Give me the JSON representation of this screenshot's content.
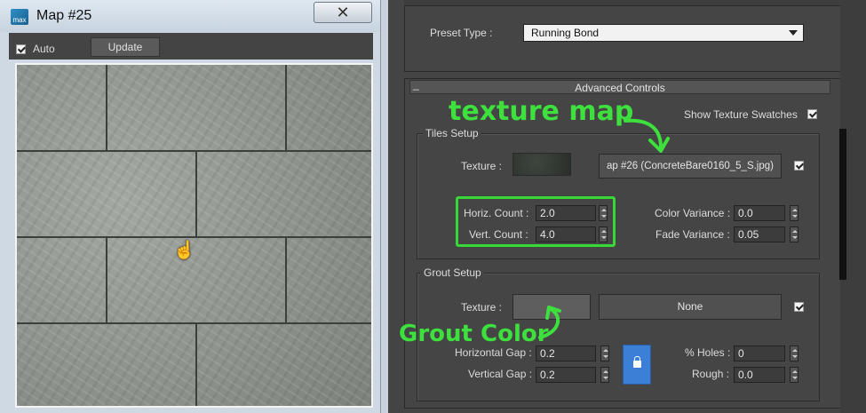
{
  "map_window": {
    "title": "Map #25",
    "close_glyph": "✕",
    "auto_label": "Auto",
    "auto_checked": true,
    "update_label": "Update"
  },
  "panel": {
    "preset_type_label": "Preset Type :",
    "preset_type_value": "Running Bond",
    "advanced_controls_title": "Advanced Controls",
    "show_texture_swatches_label": "Show Texture Swatches",
    "tiles_setup": {
      "group_label": "Tiles Setup",
      "texture_label": "Texture :",
      "texture_map_button": "ap #26 (ConcreteBare0160_5_S.jpg)",
      "horiz_count_label": "Horiz. Count :",
      "horiz_count_value": "2.0",
      "vert_count_label": "Vert. Count :",
      "vert_count_value": "4.0",
      "color_variance_label": "Color Variance :",
      "color_variance_value": "0.0",
      "fade_variance_label": "Fade Variance :",
      "fade_variance_value": "0.05"
    },
    "grout_setup": {
      "group_label": "Grout Setup",
      "texture_label": "Texture :",
      "texture_map_button": "None",
      "horizontal_gap_label": "Horizontal Gap :",
      "horizontal_gap_value": "0.2",
      "vertical_gap_label": "Vertical Gap :",
      "vertical_gap_value": "0.2",
      "holes_label": "% Holes :",
      "holes_value": "0",
      "rough_label": "Rough :",
      "rough_value": "0.0"
    }
  },
  "annotations": {
    "texture_map": "texture map",
    "grout_color": "Grout Color"
  },
  "colors": {
    "accent_lock": "#3b7fd6",
    "annotation_green": "#3de03d",
    "panel_bg": "#444444"
  },
  "icons": [
    "3dsmax-app-icon",
    "close-icon",
    "checkbox-checked-icon",
    "dropdown-arrow-icon",
    "lock-icon",
    "hand-cursor-icon"
  ]
}
